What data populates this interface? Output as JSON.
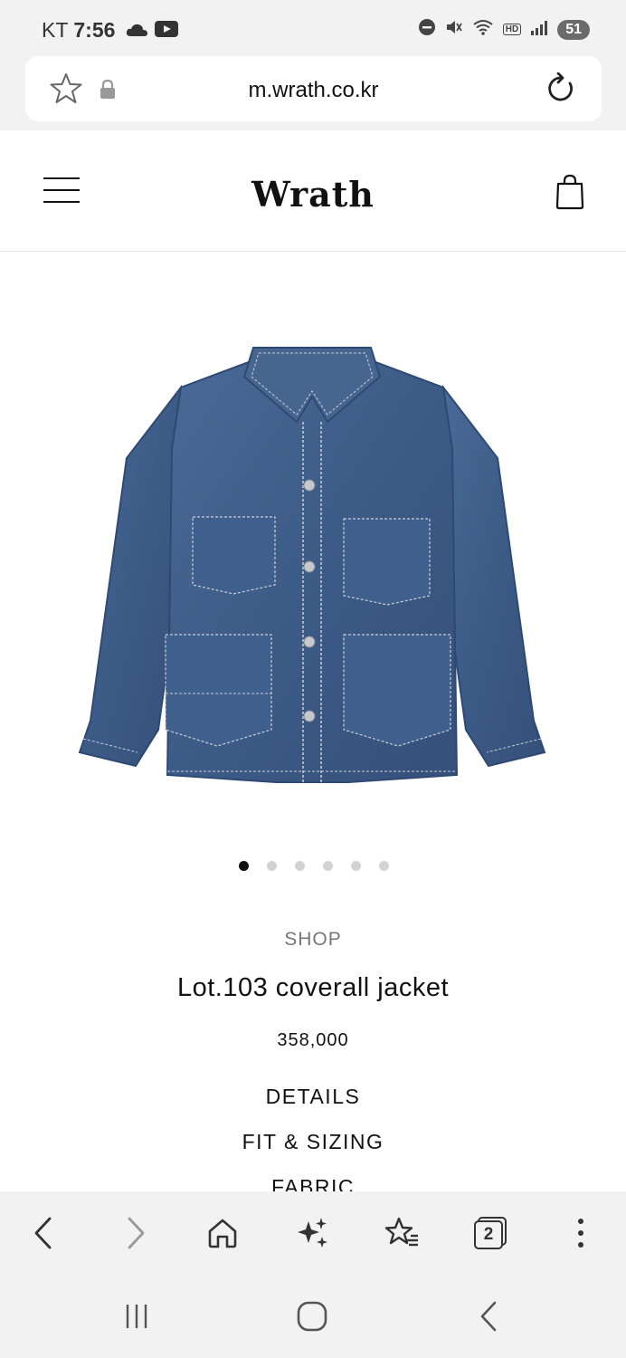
{
  "status": {
    "carrier": "KT",
    "time": "7:56",
    "battery": "51",
    "hd_label": "HD"
  },
  "browser": {
    "url": "m.wrath.co.kr",
    "open_tabs": "2"
  },
  "site": {
    "logo": "Wrath"
  },
  "product": {
    "category": "SHOP",
    "title": "Lot.103 coverall jacket",
    "price": "358,000",
    "image_count": 6,
    "active_image": 0,
    "links": [
      "DETAILS",
      "FIT & SIZING",
      "FABRIC"
    ]
  },
  "colors": {
    "denim": "#3f5f8c",
    "denim_dark": "#2e4a72",
    "stitch": "#c9cfd8"
  }
}
